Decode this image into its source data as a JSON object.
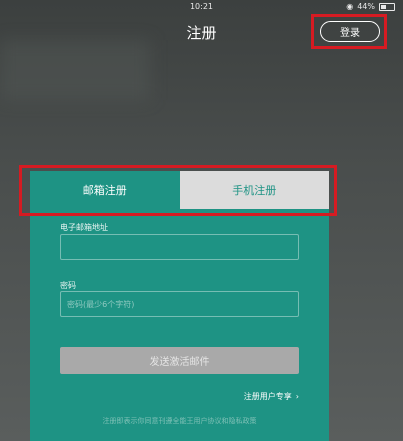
{
  "status_bar": {
    "time": "10:21",
    "battery": "44%"
  },
  "header": {
    "title": "注册",
    "login_label": "登录"
  },
  "tabs": [
    {
      "label": "邮箱注册",
      "active": true
    },
    {
      "label": "手机注册",
      "active": false
    }
  ],
  "form": {
    "email_label": "电子邮箱地址",
    "email_value": "",
    "email_placeholder": "",
    "password_label": "密码",
    "password_value": "",
    "password_placeholder": "密码(最少6个字符)",
    "submit_label": "发送激活邮件"
  },
  "vip_link": "注册用户专享",
  "terms_text": "注册即表示你同意刊遵全能王用户协议和隐私政策",
  "colors": {
    "accent": "#1e9384",
    "highlight": "#d61b22",
    "tab_inactive": "#dcdcdc",
    "disabled_button": "#a9a9a9"
  },
  "icons": {
    "battery": "battery-icon",
    "signal": "signal-icon",
    "chevron": "chevron-right-icon"
  }
}
